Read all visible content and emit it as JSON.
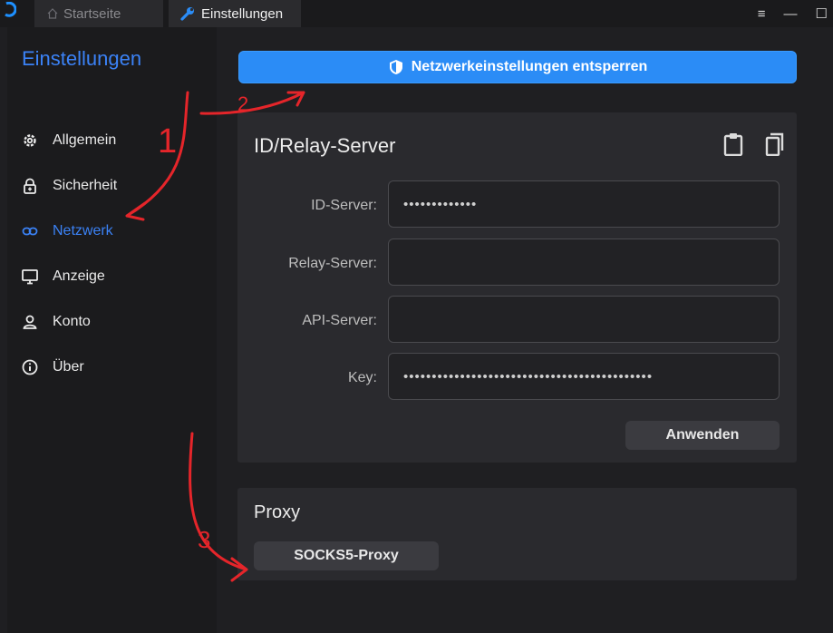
{
  "tabs": {
    "home_label": "Startseite",
    "settings_label": "Einstellungen"
  },
  "window_controls": {
    "menu": "≡",
    "minimize": "—",
    "maximize": "☐"
  },
  "sidebar": {
    "title": "Einstellungen",
    "items": [
      {
        "label": "Allgemein",
        "icon": "gear-icon"
      },
      {
        "label": "Sicherheit",
        "icon": "lock-icon"
      },
      {
        "label": "Netzwerk",
        "icon": "link-icon",
        "active": true
      },
      {
        "label": "Anzeige",
        "icon": "monitor-icon"
      },
      {
        "label": "Konto",
        "icon": "user-icon"
      },
      {
        "label": "Über",
        "icon": "info-icon"
      }
    ]
  },
  "network": {
    "unlock_label": "Netzwerkeinstellungen entsperren",
    "server_card": {
      "title": "ID/Relay-Server",
      "fields": [
        {
          "label": "ID-Server:",
          "value": "•••••••••••••"
        },
        {
          "label": "Relay-Server:",
          "value": ""
        },
        {
          "label": "API-Server:",
          "value": ""
        },
        {
          "label": "Key:",
          "value": "••••••••••••••••••••••••••••••••••••••••••••"
        }
      ],
      "apply_label": "Anwenden"
    },
    "proxy_card": {
      "title": "Proxy",
      "socks_label": "SOCKS5-Proxy"
    }
  },
  "annotations": [
    "1",
    "2",
    "3"
  ],
  "colors": {
    "accent": "#3b82f6",
    "unlock_button": "#2b8cf6",
    "annotation": "#e5252a"
  }
}
